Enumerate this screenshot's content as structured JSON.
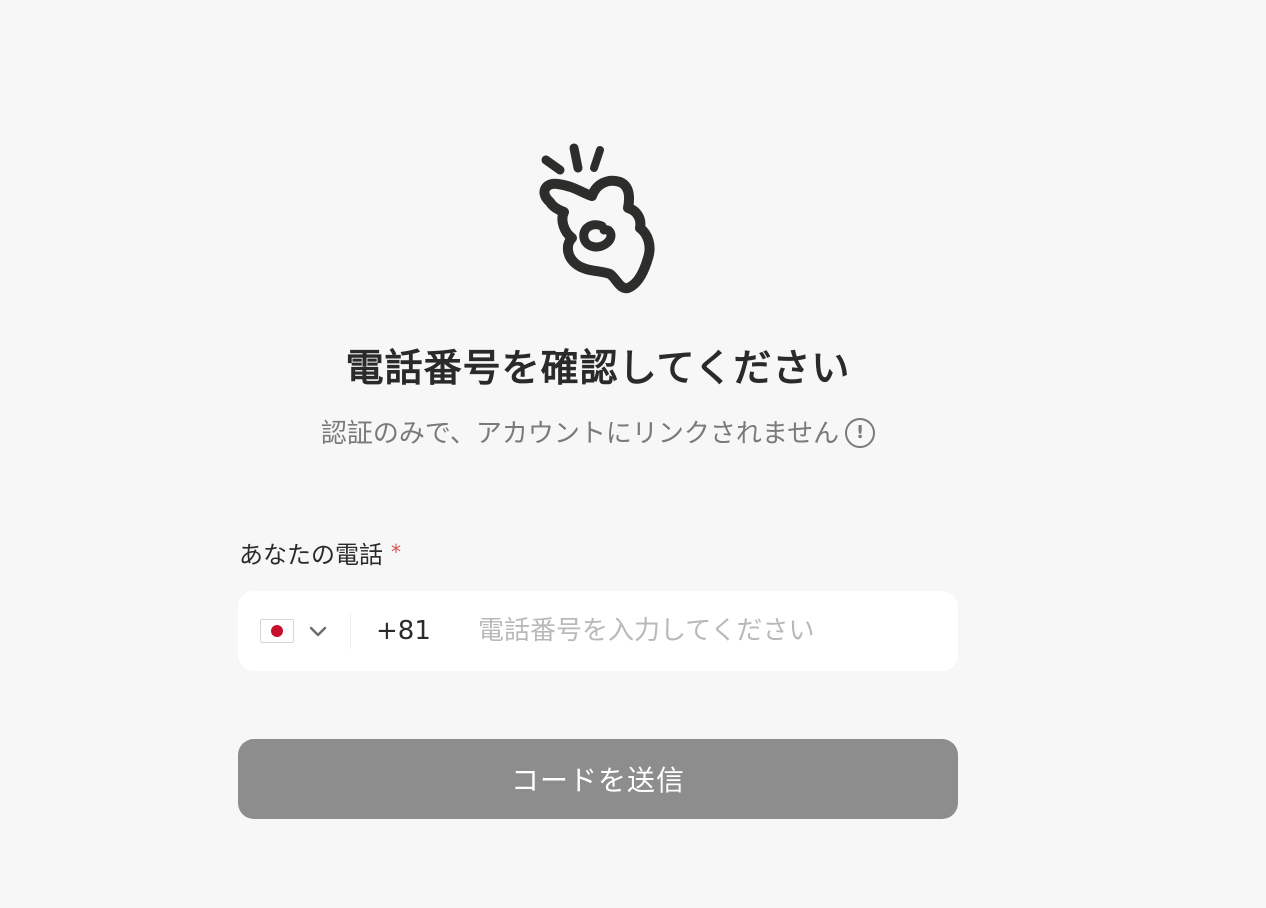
{
  "logo": {
    "icon": "hand-gesture-logo-icon"
  },
  "header": {
    "title": "電話番号を確認してください",
    "subtitle": "認証のみで、アカウントにリンクされません",
    "info_symbol": "!"
  },
  "form": {
    "phone_label": "あなたの電話",
    "required_mark": "*",
    "country": {
      "flag": "japan-flag-icon",
      "dial_code": "+81"
    },
    "phone_value": "",
    "phone_placeholder": "電話番号を入力してください",
    "submit_label": "コードを送信"
  },
  "colors": {
    "background": "#f7f7f7",
    "button_disabled": "#8d8d8d",
    "required": "#d9544f",
    "flag_red": "#c8102e"
  }
}
